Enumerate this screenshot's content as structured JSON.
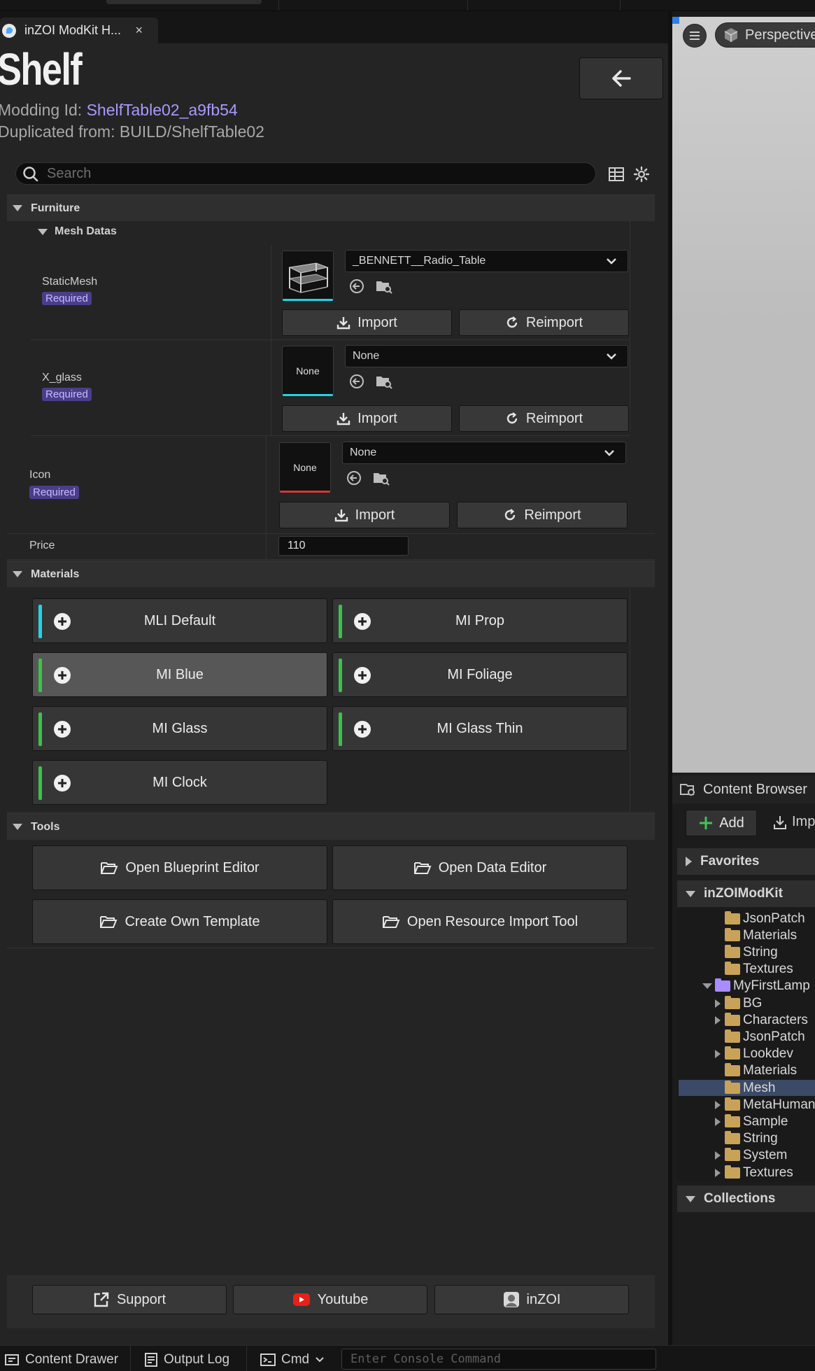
{
  "tab": {
    "title": "inZOI ModKit H...",
    "close_label": "×"
  },
  "header": {
    "title": "Shelf",
    "modding_id_label": "Modding Id:",
    "modding_id_value": "ShelfTable02_a9fb54",
    "duplicated_from": "Duplicated from: BUILD/ShelfTable02"
  },
  "search": {
    "placeholder": "Search"
  },
  "furniture": {
    "header": "Furniture",
    "mesh_datas": {
      "header": "Mesh Datas",
      "static_mesh": {
        "label": "StaticMesh",
        "required": "Required",
        "value": "_BENNETT__Radio_Table",
        "import": "Import",
        "reimport": "Reimport"
      },
      "x_glass": {
        "label": "X_glass",
        "required": "Required",
        "thumb": "None",
        "value": "None",
        "import": "Import",
        "reimport": "Reimport"
      }
    },
    "icon": {
      "label": "Icon",
      "required": "Required",
      "thumb": "None",
      "value": "None",
      "import": "Import",
      "reimport": "Reimport"
    },
    "price": {
      "label": "Price",
      "value": "110"
    }
  },
  "materials": {
    "header": "Materials",
    "items": [
      {
        "label": "MLI Default",
        "stripe": "#22d3e6",
        "selected": false
      },
      {
        "label": "MI Prop",
        "stripe": "#3bc24a",
        "selected": false
      },
      {
        "label": "MI Blue",
        "stripe": "#3bc24a",
        "selected": true
      },
      {
        "label": "MI Foliage",
        "stripe": "#3bc24a",
        "selected": false
      },
      {
        "label": "MI Glass",
        "stripe": "#3bc24a",
        "selected": false
      },
      {
        "label": "MI Glass Thin",
        "stripe": "#3bc24a",
        "selected": false
      },
      {
        "label": "MI Clock",
        "stripe": "#3bc24a",
        "selected": false
      }
    ]
  },
  "tools": {
    "header": "Tools",
    "items": [
      {
        "label": "Open Blueprint Editor"
      },
      {
        "label": "Open Data Editor"
      },
      {
        "label": "Create Own Template"
      },
      {
        "label": "Open Resource Import Tool"
      }
    ]
  },
  "footer": {
    "support": "Support",
    "youtube": "Youtube",
    "inzoi": "inZOI"
  },
  "statusbar": {
    "content_drawer": "Content Drawer",
    "output_log": "Output Log",
    "cmd": "Cmd",
    "console_placeholder": "Enter Console Command"
  },
  "viewport": {
    "perspective": "Perspective"
  },
  "content_browser": {
    "title": "Content Browser",
    "add": "Add",
    "import": "Imp",
    "favorites": "Favorites",
    "root": "inZOIModKit",
    "collections": "Collections",
    "tree": [
      {
        "label": "JsonPatch",
        "depth": 1,
        "arrow": "none",
        "open": false,
        "selected": false
      },
      {
        "label": "Materials",
        "depth": 1,
        "arrow": "none",
        "open": false,
        "selected": false
      },
      {
        "label": "String",
        "depth": 1,
        "arrow": "none",
        "open": false,
        "selected": false
      },
      {
        "label": "Textures",
        "depth": 1,
        "arrow": "none",
        "open": false,
        "selected": false
      },
      {
        "label": "MyFirstLamp",
        "depth": 0,
        "arrow": "down",
        "open": true,
        "selected": false
      },
      {
        "label": "BG",
        "depth": 1,
        "arrow": "right",
        "open": false,
        "selected": false
      },
      {
        "label": "Characters",
        "depth": 1,
        "arrow": "right",
        "open": false,
        "selected": false
      },
      {
        "label": "JsonPatch",
        "depth": 1,
        "arrow": "none",
        "open": false,
        "selected": false
      },
      {
        "label": "Lookdev",
        "depth": 1,
        "arrow": "right",
        "open": false,
        "selected": false
      },
      {
        "label": "Materials",
        "depth": 1,
        "arrow": "none",
        "open": false,
        "selected": false
      },
      {
        "label": "Mesh",
        "depth": 1,
        "arrow": "none",
        "open": false,
        "selected": true
      },
      {
        "label": "MetaHuman",
        "depth": 1,
        "arrow": "right",
        "open": false,
        "selected": false
      },
      {
        "label": "Sample",
        "depth": 1,
        "arrow": "right",
        "open": false,
        "selected": false
      },
      {
        "label": "String",
        "depth": 1,
        "arrow": "none",
        "open": false,
        "selected": false
      },
      {
        "label": "System",
        "depth": 1,
        "arrow": "right",
        "open": false,
        "selected": false
      },
      {
        "label": "Textures",
        "depth": 1,
        "arrow": "right",
        "open": false,
        "selected": false
      }
    ]
  },
  "colors": {
    "accent_purple": "#a79aff",
    "required_bg": "#4a3e8a",
    "cyan": "#22d3e6",
    "green": "#3bc24a",
    "red": "#d2383c"
  }
}
